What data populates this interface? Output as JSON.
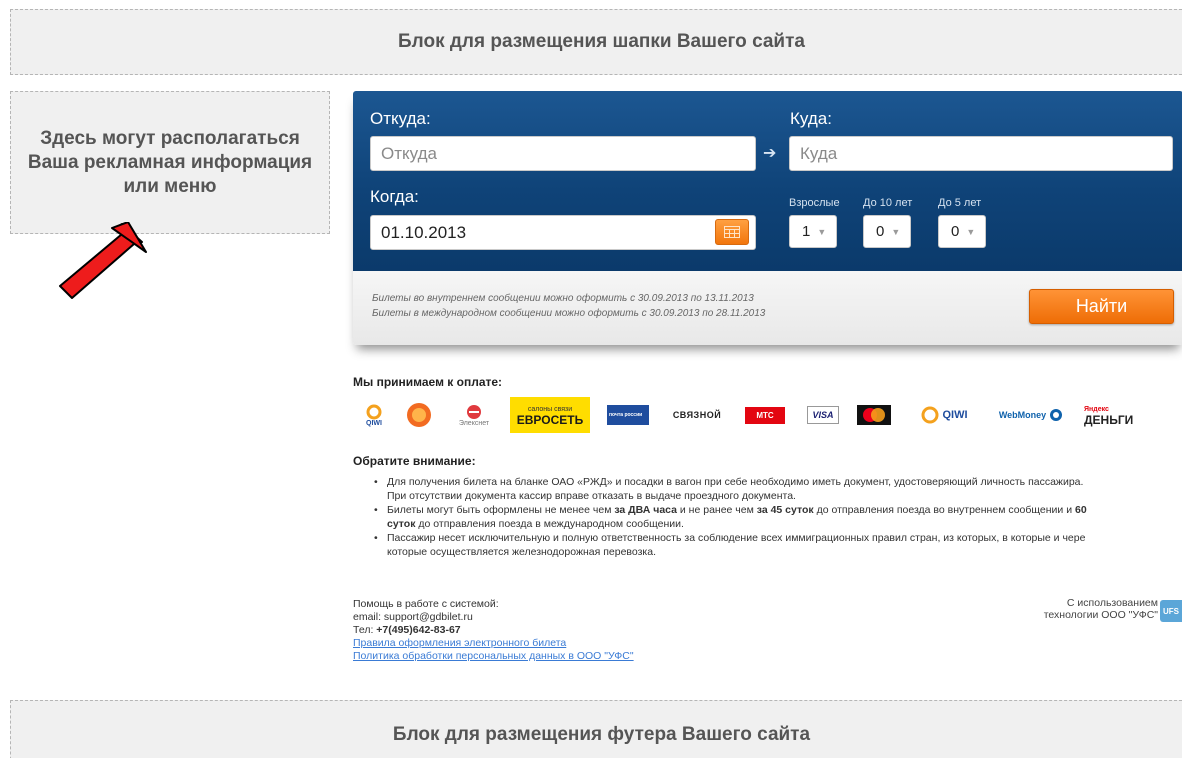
{
  "header_block": "Блок для размещения шапки Вашего сайта",
  "footer_block": "Блок для размещения футера Вашего сайта",
  "ad_block": "Здесь могут располагаться Ваша рекламная информация или меню",
  "search": {
    "from_label": "Откуда:",
    "from_placeholder": "Откуда",
    "to_label": "Куда:",
    "to_placeholder": "Куда",
    "when_label": "Когда:",
    "date_value": "01.10.2013",
    "adults_label": "Взрослые",
    "adults_value": "1",
    "under10_label": "До 10 лет",
    "under10_value": "0",
    "under5_label": "До 5 лет",
    "under5_value": "0",
    "info_domestic": "Билеты во внутреннем сообщении можно оформить с 30.09.2013 по 13.11.2013",
    "info_international": "Билеты в международном сообщении можно оформить с 30.09.2013 по 28.11.2013",
    "find_button": "Найти"
  },
  "payment": {
    "title": "Мы принимаем к оплате:",
    "logos": [
      {
        "name": "qiwi-small",
        "text": "QIWI",
        "color": "#f4a11d"
      },
      {
        "name": "svyaznoy-kassa",
        "text": "",
        "color": "#f26b21"
      },
      {
        "name": "elecsnet",
        "text": "Элекснет",
        "color": "#e03a3e"
      },
      {
        "name": "evroset",
        "text1": "салоны связи",
        "text2": "ЕВРОСЕТЬ",
        "color": "#ffdd00"
      },
      {
        "name": "pochta-rossii",
        "text": "почта россии",
        "color": "#1f4d9e"
      },
      {
        "name": "svyaznoy",
        "text": "СВЯЗНОЙ",
        "color": "#333333"
      },
      {
        "name": "mts",
        "text": "МТС",
        "color": "#e30611"
      },
      {
        "name": "visa",
        "text": "VISA",
        "color": "#1a1f71"
      },
      {
        "name": "mastercard",
        "text": "MasterCard",
        "color": "#f79e1b"
      },
      {
        "name": "qiwi",
        "text": "QIWI",
        "color": "#f4a11d"
      },
      {
        "name": "webmoney",
        "text": "WebMoney",
        "color": "#0f62ac"
      },
      {
        "name": "yandex-money",
        "text1": "Яндекс",
        "text2": "ДЕНЬГИ",
        "color": "#f8a41c"
      }
    ]
  },
  "notice": {
    "title": "Обратите внимание:",
    "line1": "Для получения билета на бланке ОАО «РЖД» и посадки в вагон при себе необходимо иметь документ, удостоверяющий личность пассажира.",
    "line1b": "При отсутствии документа кассир вправе отказать в выдаче проездного документа.",
    "line2_a": "Билеты могут быть оформлены не менее чем ",
    "line2_b": "за ДВА часа",
    "line2_c": " и не ранее чем ",
    "line2_d": "за 45 суток",
    "line2_e": " до отправления поезда во внутреннем сообщении и ",
    "line2_f": "60",
    "line2b_a": "суток",
    "line2b_b": " до отправления поезда в международном сообщении.",
    "line3": "Пассажир несет исключительную и полную ответственность за соблюдение всех иммиграционных правил стран, из которых, в которые и чере",
    "line3b": "которые осуществляется железнодорожная перевозка."
  },
  "help": {
    "line1": "Помощь в работе с системой:",
    "line2": "email: support@gdbilet.ru",
    "phone_label": "Тел: ",
    "phone": "+7(495)642-83-67",
    "link1": "Правила оформления электронного билета",
    "link2": "Политика обработки персональных данных в ООО \"УФС\"",
    "tech1": "С использованием",
    "tech2": "технологии ООО \"УФС\"",
    "ufs": "UFS"
  }
}
